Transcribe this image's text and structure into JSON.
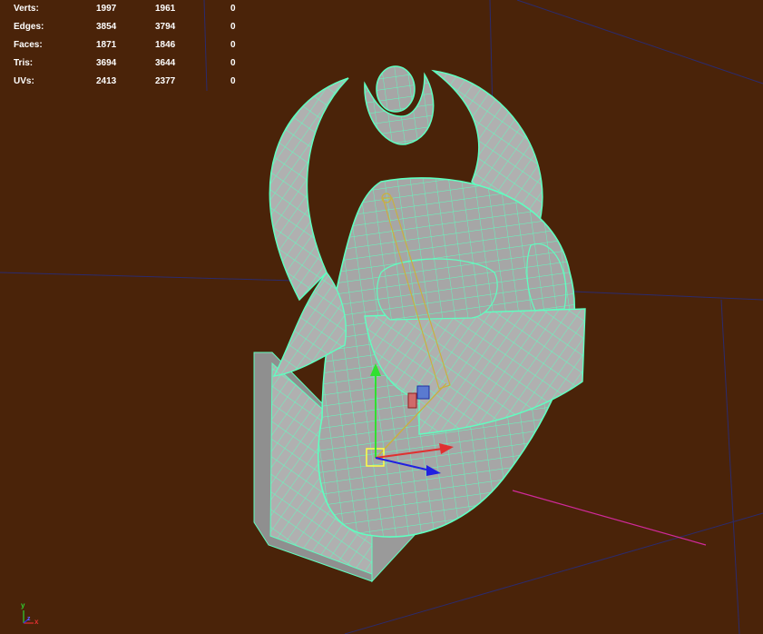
{
  "hud": {
    "rows": [
      {
        "label": "Verts:",
        "v1": "1997",
        "v2": "1961",
        "v3": "0"
      },
      {
        "label": "Edges:",
        "v1": "3854",
        "v2": "3794",
        "v3": "0"
      },
      {
        "label": "Faces:",
        "v1": "1871",
        "v2": "1846",
        "v3": "0"
      },
      {
        "label": "Tris:",
        "v1": "3694",
        "v2": "3644",
        "v3": "0"
      },
      {
        "label": "UVs:",
        "v1": "2413",
        "v2": "2377",
        "v3": "0"
      }
    ]
  },
  "axis": {
    "y": "y",
    "x": "x",
    "z": "z"
  },
  "colors": {
    "background": "#4a2309",
    "wireframe": "#5fffc0",
    "mesh_fill": "#a9a9a9",
    "grid_line": "#2b2b6e"
  },
  "icons": {
    "manipulator": "move-manipulator-icon",
    "view_axis": "view-axis-icon"
  }
}
